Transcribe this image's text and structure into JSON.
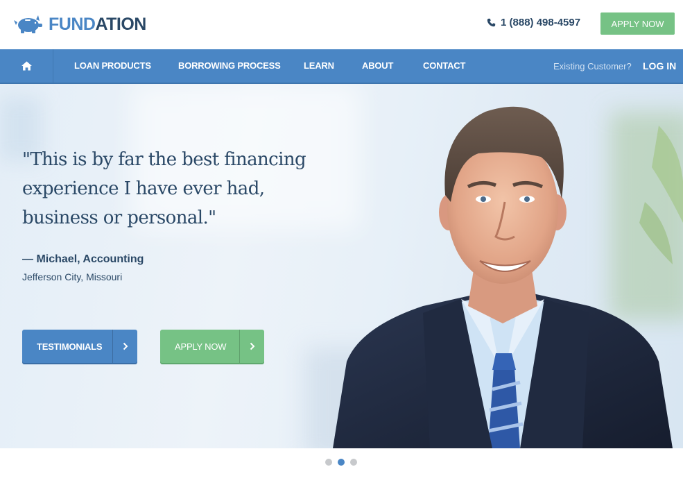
{
  "header": {
    "logo_part1": "FUND",
    "logo_part2": "ATION",
    "logo_icon": "piggy-bank-icon",
    "phone": "1 (888) 498-4597",
    "apply_button": "APPLY NOW"
  },
  "nav": {
    "home_icon": "home-icon",
    "items": [
      {
        "label": "LOAN PRODUCTS"
      },
      {
        "label": "BORROWING PROCESS"
      },
      {
        "label": "LEARN"
      },
      {
        "label": "ABOUT"
      },
      {
        "label": "CONTACT"
      }
    ],
    "existing_customer": "Existing Customer?",
    "login": "LOG IN"
  },
  "hero": {
    "quote": "\"This is by far the best financing experience I have ever had, business or personal.\"",
    "author": "— Michael, Accounting",
    "location": "Jefferson City, Missouri",
    "buttons": {
      "testimonials": "TESTIMONIALS",
      "apply": "APPLY NOW"
    }
  },
  "slider": {
    "total_slides": 3,
    "active_slide": 2
  },
  "colors": {
    "brand_blue": "#4a86c5",
    "brand_navy": "#2a4866",
    "accent_green": "#76c285"
  }
}
